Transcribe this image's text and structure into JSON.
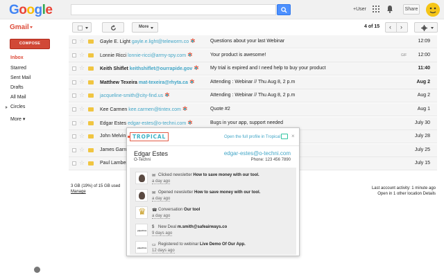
{
  "header": {
    "logo_letters": [
      {
        "ch": "G",
        "color": "#4285f4"
      },
      {
        "ch": "o",
        "color": "#ea4335"
      },
      {
        "ch": "o",
        "color": "#fbbc05"
      },
      {
        "ch": "g",
        "color": "#4285f4"
      },
      {
        "ch": "l",
        "color": "#34a853"
      },
      {
        "ch": "e",
        "color": "#ea4335"
      }
    ],
    "search_value": "",
    "search_icon": "search-icon",
    "plus_user": "+User",
    "apps_icon": "apps-grid-icon",
    "notifications_icon": "bell-icon",
    "share_label": "Share",
    "avatar_icon": "profile-avatar"
  },
  "toolbar": {
    "gmail_label": "Gmail",
    "more_label": "More",
    "page_range": "4 of 15",
    "prev_icon": "chevron-left-icon",
    "next_icon": "chevron-right-icon",
    "settings_icon": "gear-icon"
  },
  "sidebar": {
    "compose_label": "COMPOSE",
    "items": [
      {
        "label": "Inbox",
        "active": true
      },
      {
        "label": "Starred"
      },
      {
        "label": "Sent Mail"
      },
      {
        "label": "Drafts"
      },
      {
        "label": "All Mail"
      },
      {
        "label": "Circles"
      },
      {
        "label": "More ▾"
      }
    ]
  },
  "emails": [
    {
      "name": "Gayle E. Light",
      "email": "gayle.e.light@teleworm.co",
      "subject": "Questions about your last Webinar",
      "date": "12:09",
      "bold": false
    },
    {
      "name": "Lonnie Ricci",
      "email": "lonnie-ricci@army-spy.com",
      "subject": "Your product is awesome!",
      "date": "12:00",
      "bold": false,
      "gif": "GIF"
    },
    {
      "name": "Keith Shiflet",
      "email": "keithshiflet@ourrapide.gov",
      "subject": "My trial is expired and I need help to buy your product",
      "date": "11:40",
      "bold": true
    },
    {
      "name": "Matthew Texeira",
      "email": "mat-texeira@rhyta.ca",
      "subject": "Attending : Webinar // Thu Aug 8, 2 p.m",
      "date": "Aug 2",
      "bold": true
    },
    {
      "name": "",
      "email": "jacqueline-smith@city-find.us",
      "subject": "Attending : Webinar // Thu Aug 8, 2 p.m",
      "date": "Aug 2",
      "bold": false
    },
    {
      "name": "Kee Carmen",
      "email": "kee.carmen@tintex.com",
      "subject": "Quote #2",
      "date": "Aug 1",
      "bold": false
    },
    {
      "name": "Edgar Estes",
      "email": "edgar-estes@o-techni.com",
      "subject": "Bugs in your app, support needed",
      "date": "July 30",
      "bold": false
    },
    {
      "name": "John Melvin",
      "email": "",
      "subject": "",
      "date": "July 28",
      "bold": false
    },
    {
      "name": "James Garrc",
      "email": "",
      "subject": "",
      "date": "July 25",
      "bold": false
    },
    {
      "name": "Paul Lamber",
      "email": "",
      "subject": "",
      "date": "July 15",
      "bold": false
    }
  ],
  "footer": {
    "storage": "3 GB (19%) of 15 GB used",
    "manage": "Manage",
    "activity_line1": "Last account activity: 1 minute ago",
    "activity_line2": "Open in 1 other location Details"
  },
  "popup": {
    "logo": "TROPICAL",
    "open_link": "Open the full profile in Tropical",
    "close": "×",
    "name": "Edgar Estes",
    "company": "O-Techni",
    "email": "edgar-estes@o-techni.com",
    "phone": "Phone:   123 456 7890",
    "timeline": [
      {
        "img": "mail",
        "icon": "✉",
        "prefix": "Clicked newsletter",
        "bold": "How to save money with our tool.",
        "time": "a day ago"
      },
      {
        "img": "mail",
        "icon": "✉",
        "prefix": "Opened newsletter",
        "bold": "How to save money with our tool.",
        "time": "a day ago"
      },
      {
        "img": "crown",
        "icon": "☎",
        "prefix": "Conversation",
        "bold": "Our tool",
        "time": "a day ago"
      },
      {
        "img": "pipe",
        "icon": "$",
        "prefix": "New Deal",
        "bold": "m.smith@safeairways.co",
        "time": "9 days ago"
      },
      {
        "img": "pipe",
        "icon": "▭",
        "prefix": "Registered to webinar",
        "bold": "Live Demo Of Our App.",
        "time": "12 days ago"
      }
    ]
  }
}
